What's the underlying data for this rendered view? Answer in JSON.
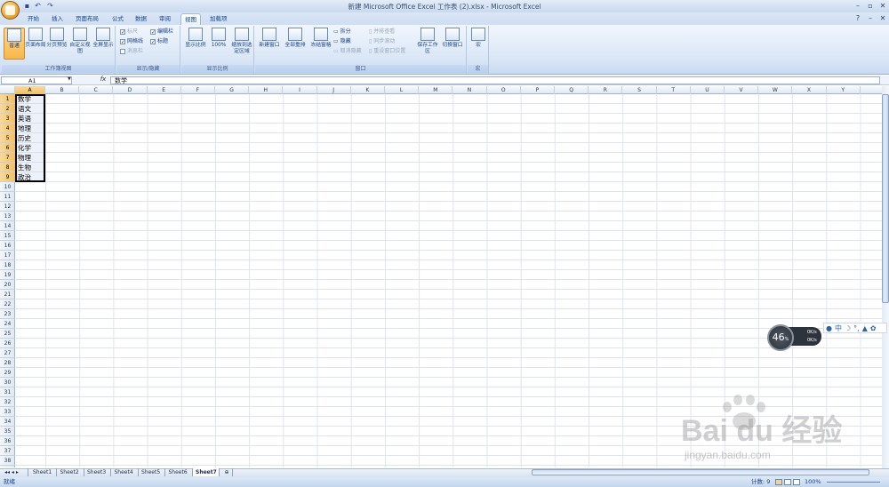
{
  "window": {
    "title": "新建 Microsoft Office Excel 工作表 (2).xlsx - Microsoft Excel"
  },
  "quick_access": {
    "save_icon": "save-icon",
    "undo_icon": "undo-icon",
    "redo_icon": "redo-icon"
  },
  "tabs": [
    "开始",
    "插入",
    "页面布局",
    "公式",
    "数据",
    "审阅",
    "视图",
    "加载项"
  ],
  "active_tab": "视图",
  "ribbon": {
    "workbook_views": {
      "label": "工作簿视图",
      "buttons": [
        "普通",
        "页面布局",
        "分页预览",
        "自定义视图",
        "全屏显示"
      ]
    },
    "show_hide": {
      "label": "显示/隐藏",
      "items": [
        {
          "label": "标尺",
          "checked": true,
          "enabled": false
        },
        {
          "label": "网格线",
          "checked": true,
          "enabled": true
        },
        {
          "label": "消息栏",
          "checked": false,
          "enabled": false
        },
        {
          "label": "编辑栏",
          "checked": true,
          "enabled": true
        },
        {
          "label": "标题",
          "checked": true,
          "enabled": true
        }
      ]
    },
    "zoom": {
      "label": "显示比例",
      "buttons": [
        "显示比例",
        "100%",
        "缩放到选定区域"
      ]
    },
    "window": {
      "label": "窗口",
      "buttons": [
        "新建窗口",
        "全部重排",
        "冻结窗格",
        "拆分",
        "隐藏",
        "取消隐藏",
        "并排查看",
        "同步滚动",
        "重设窗口位置",
        "保存工作区",
        "切换窗口"
      ]
    },
    "macro": {
      "label": "宏",
      "buttons": [
        "宏"
      ]
    }
  },
  "formula_bar": {
    "name_box": "A1",
    "fx": "fx",
    "content": "数学"
  },
  "columns": [
    "A",
    "B",
    "C",
    "D",
    "E",
    "F",
    "G",
    "H",
    "I",
    "J",
    "K",
    "L",
    "M",
    "N",
    "O",
    "P",
    "Q",
    "R",
    "S",
    "T",
    "U",
    "V",
    "W",
    "X",
    "Y"
  ],
  "rows": [
    "1",
    "2",
    "3",
    "4",
    "5",
    "6",
    "7",
    "8",
    "9",
    "10",
    "11",
    "12",
    "13",
    "14",
    "15",
    "16",
    "17",
    "18",
    "19",
    "20",
    "21",
    "22",
    "23",
    "24",
    "25",
    "26",
    "27",
    "28",
    "29",
    "30",
    "31",
    "32",
    "33",
    "34",
    "35",
    "36",
    "37",
    "38"
  ],
  "cells_A": [
    "数学",
    "语文",
    "英语",
    "地理",
    "历史",
    "化学",
    "物理",
    "生物",
    "政治"
  ],
  "sheets": [
    "Sheet1",
    "Sheet2",
    "Sheet3",
    "Sheet4",
    "Sheet5",
    "Sheet6",
    "Sheet7"
  ],
  "active_sheet": "Sheet7",
  "status": {
    "ready": "就绪",
    "count": "计数: 9",
    "zoom": "100%"
  },
  "overlay": {
    "gauge": "46",
    "gauge_unit": "%",
    "up": "0K/s",
    "down": "0K/s",
    "ime": "中"
  },
  "watermark": {
    "brand": "Bai du 经验",
    "url": "jingyan.baidu.com"
  }
}
